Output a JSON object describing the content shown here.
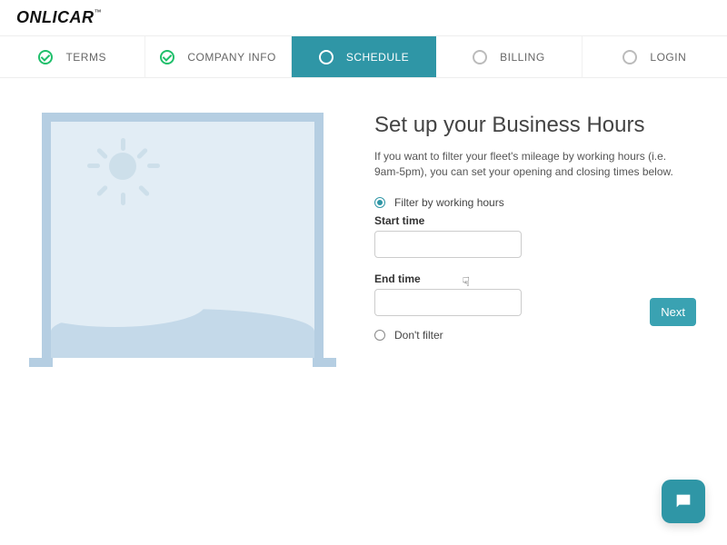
{
  "brand": {
    "name": "ONLICAR",
    "tm": "™"
  },
  "steps": [
    {
      "label": "TERMS",
      "state": "done"
    },
    {
      "label": "COMPANY INFO",
      "state": "done"
    },
    {
      "label": "SCHEDULE",
      "state": "active"
    },
    {
      "label": "BILLING",
      "state": "pending"
    },
    {
      "label": "LOGIN",
      "state": "pending"
    }
  ],
  "form": {
    "heading": "Set up your Business Hours",
    "description": "If you want to filter your fleet's mileage by working hours (i.e. 9am-5pm), you can set your opening and closing times below.",
    "option_filter_label": "Filter by working hours",
    "option_nofilter_label": "Don't filter",
    "start_label": "Start time",
    "end_label": "End time",
    "start_value": "",
    "end_value": "",
    "selected": "filter",
    "next_label": "Next"
  },
  "icons": {
    "chat": "chat-bubble"
  }
}
